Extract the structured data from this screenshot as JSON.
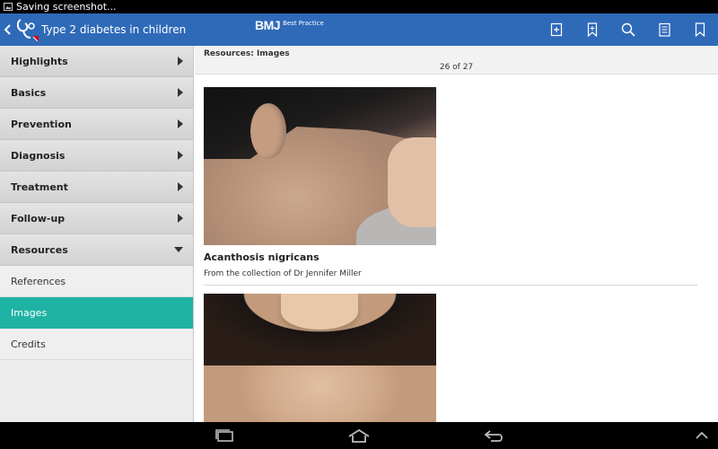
{
  "status_bar": {
    "text": "Saving screenshot..."
  },
  "app_bar": {
    "title": "Type 2 diabetes in children",
    "brand": "BMJ",
    "brand_sub": "Best Practice"
  },
  "sidebar": {
    "items": [
      {
        "label": "Highlights",
        "expanded": false
      },
      {
        "label": "Basics",
        "expanded": false
      },
      {
        "label": "Prevention",
        "expanded": false
      },
      {
        "label": "Diagnosis",
        "expanded": false
      },
      {
        "label": "Treatment",
        "expanded": false
      },
      {
        "label": "Follow-up",
        "expanded": false
      },
      {
        "label": "Resources",
        "expanded": true
      }
    ],
    "sub_items": [
      {
        "label": "References",
        "active": false
      },
      {
        "label": "Images",
        "active": true
      },
      {
        "label": "Credits",
        "active": false
      }
    ]
  },
  "main": {
    "breadcrumb": "Resources: Images",
    "pager": "26 of 27",
    "images": [
      {
        "title": "Acanthosis nigricans",
        "credit": "From the collection of Dr Jennifer Miller"
      }
    ]
  },
  "colors": {
    "app_bar": "#2f6ab9",
    "active_item": "#1fb3a4",
    "sidebar_bg": "#ececec"
  }
}
